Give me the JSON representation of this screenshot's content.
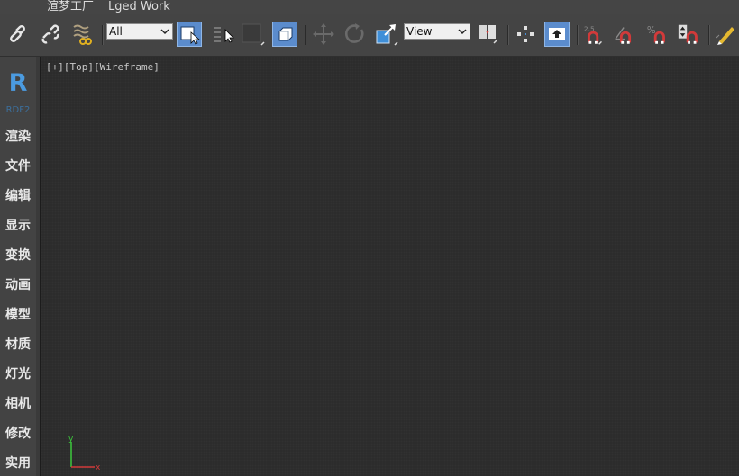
{
  "menubar": {
    "items": [
      "渲梦工厂",
      "Lged Work"
    ]
  },
  "toolbar": {
    "selection_filter": {
      "value": "All"
    },
    "ref_coord": {
      "value": "View"
    },
    "icons": [
      "link-icon",
      "unlink-icon",
      "bind-space-warp-icon",
      "select-object-icon",
      "select-by-name-icon",
      "rectangular-selection-icon",
      "window-crossing-icon",
      "select-move-icon",
      "select-rotate-icon",
      "select-scale-icon",
      "placement-icon",
      "use-pivot-center-icon",
      "select-manipulate-icon",
      "snap-2d-icon",
      "snap-angle-icon",
      "snap-percent-icon",
      "snap-spinner-icon",
      "edit-named-sets-icon"
    ],
    "colors": {
      "active": "#5b8ccd",
      "magnet_red": "#d23a3a"
    }
  },
  "sidebar": {
    "logo": "R",
    "logo_sub": "RDF2",
    "items": [
      {
        "label": "渲染"
      },
      {
        "label": "文件"
      },
      {
        "label": "编辑"
      },
      {
        "label": "显示"
      },
      {
        "label": "变换"
      },
      {
        "label": "动画"
      },
      {
        "label": "模型"
      },
      {
        "label": "材质"
      },
      {
        "label": "灯光"
      },
      {
        "label": "相机"
      },
      {
        "label": "修改"
      },
      {
        "label": "实用"
      }
    ]
  },
  "viewport": {
    "label_plus": "[+]",
    "label_view": "[Top]",
    "label_shading": "[Wireframe]",
    "gizmo": {
      "y_label": "y",
      "x_label": "x"
    }
  }
}
